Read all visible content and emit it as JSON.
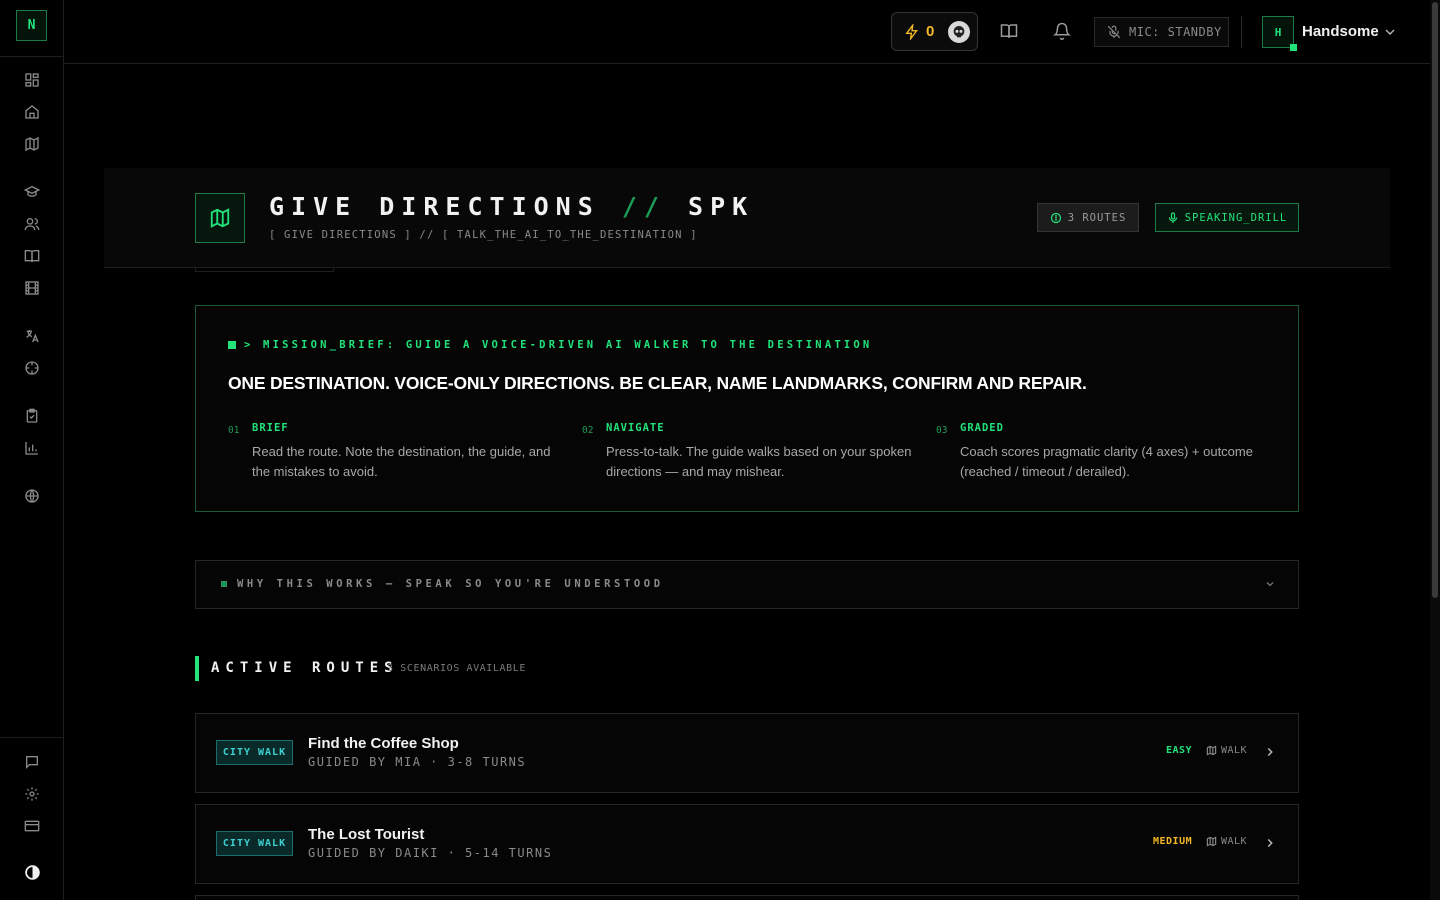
{
  "brand": {
    "logo_letter": "N",
    "accent": "#22e27a"
  },
  "sidebar": {
    "items": [
      {
        "icon": "dashboard-icon"
      },
      {
        "icon": "home-icon"
      },
      {
        "icon": "map-icon"
      },
      {
        "icon": "graduation-cap-icon"
      },
      {
        "icon": "users-icon"
      },
      {
        "icon": "book-icon"
      },
      {
        "icon": "film-icon"
      },
      {
        "icon": "translate-icon"
      },
      {
        "icon": "crosshair-icon"
      },
      {
        "icon": "clipboard-icon"
      },
      {
        "icon": "bar-chart-icon"
      },
      {
        "icon": "globe-icon"
      }
    ],
    "bottom_items": [
      {
        "icon": "chat-icon"
      },
      {
        "icon": "settings-icon"
      },
      {
        "icon": "credit-card-icon"
      },
      {
        "icon": "theme-toggle-icon"
      }
    ]
  },
  "header": {
    "xp_value": "0",
    "mic_status": "MIC: STANDBY",
    "user_initial": "H",
    "user_name": "Handsome"
  },
  "hero": {
    "title_part1": "GIVE DIRECTIONS",
    "title_sep": "//",
    "title_part2": "SPK",
    "subtitle": "[ GIVE DIRECTIONS ] // [ TALK_THE_AI_TO_THE_DESTINATION ]",
    "routes_badge": "3 ROUTES",
    "mode_badge": "SPEAKING_DRILL"
  },
  "mission": {
    "kicker": "> MISSION_BRIEF: GUIDE A VOICE-DRIVEN AI WALKER TO THE DESTINATION",
    "headline": "ONE DESTINATION. VOICE-ONLY DIRECTIONS. BE CLEAR, NAME LANDMARKS, CONFIRM AND REPAIR.",
    "steps": [
      {
        "num": "01",
        "title": "BRIEF",
        "desc": "Read the route. Note the destination, the guide, and the mistakes to avoid."
      },
      {
        "num": "02",
        "title": "NAVIGATE",
        "desc": "Press-to-talk. The guide walks based on your spoken directions — and may mishear."
      },
      {
        "num": "03",
        "title": "GRADED",
        "desc": "Coach scores pragmatic clarity (4 axes) + outcome (reached / timeout / derailed)."
      }
    ]
  },
  "why": {
    "label": "WHY THIS WORKS — SPEAK SO YOU'RE UNDERSTOOD"
  },
  "active_routes": {
    "title": "ACTIVE ROUTES",
    "count_label": "3 SCENARIOS AVAILABLE",
    "routes": [
      {
        "tag": "CITY WALK",
        "name": "Find the Coffee Shop",
        "meta": "GUIDED BY MIA · 3-8 TURNS",
        "difficulty": "EASY",
        "difficulty_color": "#22e27a",
        "mode": "WALK"
      },
      {
        "tag": "CITY WALK",
        "name": "The Lost Tourist",
        "meta": "GUIDED BY DAIKI · 5-14 TURNS",
        "difficulty": "MEDIUM",
        "difficulty_color": "#f4b928",
        "mode": "WALK"
      }
    ]
  }
}
